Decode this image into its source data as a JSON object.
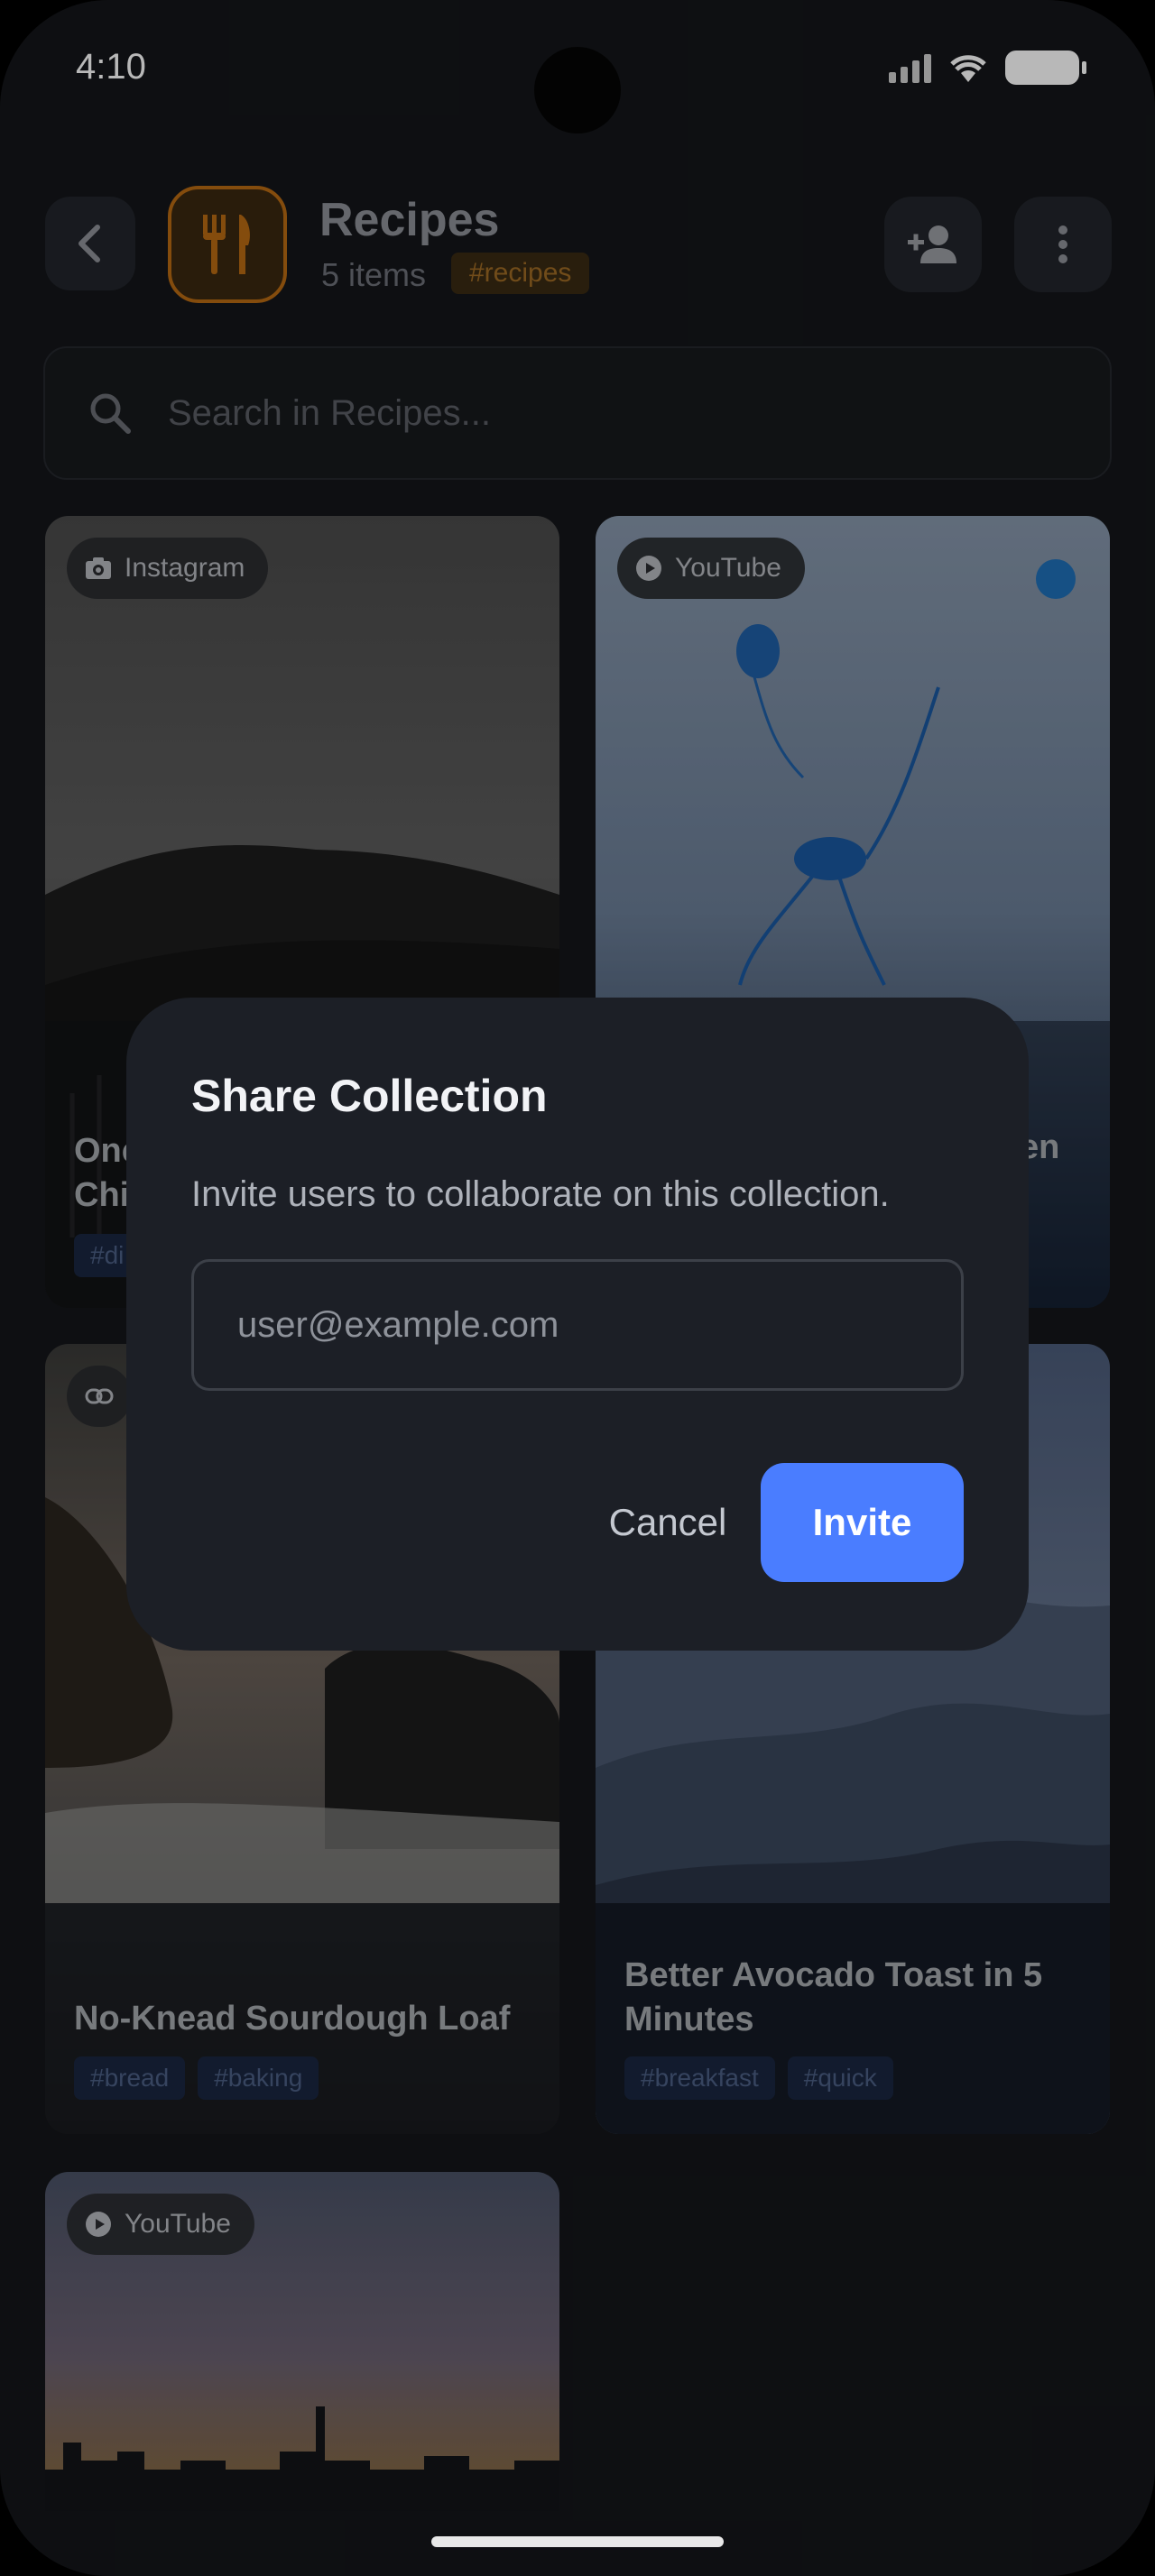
{
  "status_bar": {
    "time": "4:10"
  },
  "header": {
    "title": "Recipes",
    "count": "5 items",
    "tag": "#recipes"
  },
  "search": {
    "placeholder": "Search in Recipes..."
  },
  "cards": [
    {
      "source": "Instagram",
      "source_icon": "camera-icon",
      "title_partial": "One\nChi",
      "tags": [
        "#di"
      ]
    },
    {
      "source": "YouTube",
      "source_icon": "play-icon",
      "title_partial": "en",
      "tags": []
    },
    {
      "source": "",
      "source_icon": "link-icon",
      "title": "No-Knead Sourdough Loaf",
      "tags": [
        "#bread",
        "#baking"
      ]
    },
    {
      "source": "",
      "source_icon": "",
      "title": "Better Avocado Toast in 5 Minutes",
      "tags": [
        "#breakfast",
        "#quick"
      ]
    },
    {
      "source": "YouTube",
      "source_icon": "play-icon",
      "title": "",
      "tags": []
    }
  ],
  "dialog": {
    "title": "Share Collection",
    "description": "Invite users to collaborate on this collection.",
    "input_placeholder": "user@example.com",
    "cancel_label": "Cancel",
    "invite_label": "Invite"
  },
  "colors": {
    "accent": "#4a7dff",
    "collection_accent": "#b86a12",
    "background": "#141619",
    "dialog_bg": "#1c1f26"
  }
}
